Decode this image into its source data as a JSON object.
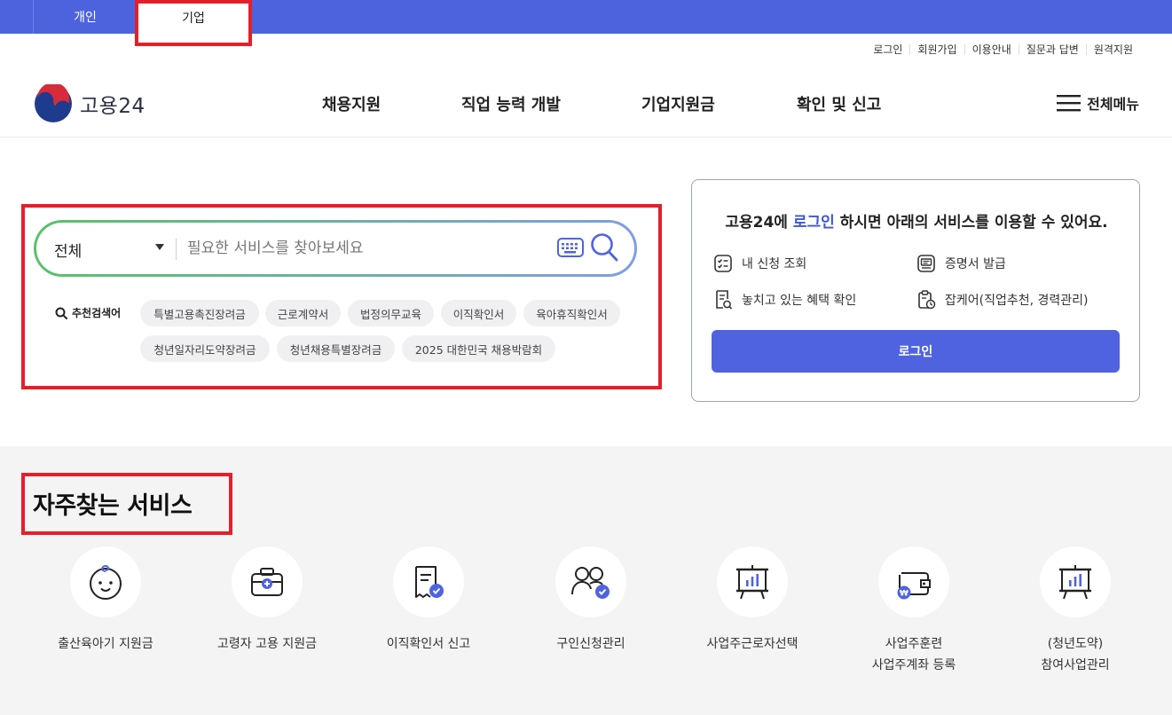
{
  "top_tabs": {
    "personal": "개인",
    "corporate": "기업"
  },
  "util_links": [
    "로그인",
    "회원가입",
    "이용안내",
    "질문과 답변",
    "원격지원"
  ],
  "logo": {
    "text": "고용24"
  },
  "gnb": [
    "채용지원",
    "직업 능력 개발",
    "기업지원금",
    "확인 및 신고"
  ],
  "all_menu": "전체메뉴",
  "search": {
    "category": "전체",
    "placeholder": "필요한 서비스를 찾아보세요",
    "reco_label": "추천검색어",
    "keywords": [
      "특별고용촉진장려금",
      "근로계약서",
      "법정의무교육",
      "이직확인서",
      "육아휴직확인서",
      "청년일자리도약장려금",
      "청년채용특별장려금",
      "2025 대한민국 채용박람회"
    ]
  },
  "login_card": {
    "title_prefix": "고용24에 ",
    "title_highlight": "로그인",
    "title_suffix": " 하시면 아래의 서비스를 이용할 수 있어요.",
    "items": [
      "내 신청 조회",
      "증명서 발급",
      "놓치고 있는 혜택 확인",
      "잡케어(직업추천, 경력관리)"
    ],
    "button": "로그인"
  },
  "services": {
    "title": "자주찾는 서비스",
    "items": [
      {
        "label": "출산육아기 지원금",
        "icon": "baby-icon"
      },
      {
        "label": "고령자 고용 지원금",
        "icon": "first-aid-bag-icon"
      },
      {
        "label": "이직확인서 신고",
        "icon": "receipt-check-icon"
      },
      {
        "label": "구인신청관리",
        "icon": "users-check-icon"
      },
      {
        "label": "사업주근로자선택",
        "icon": "presentation-board-icon"
      },
      {
        "label": "사업주훈련",
        "label2": "사업주계좌 등록",
        "icon": "wallet-won-icon"
      },
      {
        "label": "(청년도약)",
        "label2": "참여사업관리",
        "icon": "presentation-board-icon"
      }
    ]
  },
  "colors": {
    "primary": "#4d63de",
    "highlight_box": "#e3202a",
    "accent_blue": "#3d56d6"
  }
}
